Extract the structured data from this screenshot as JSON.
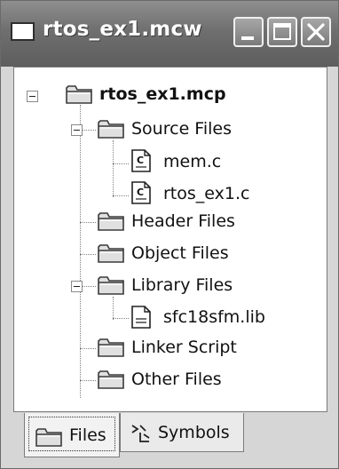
{
  "window": {
    "title": "rtos_ex1.mcw",
    "icon": "workspace-window-icon",
    "controls": {
      "minimize": "minimize-icon",
      "maximize": "maximize-icon",
      "close": "close-icon"
    }
  },
  "tree": {
    "project": "rtos_ex1.mcp",
    "folders": {
      "source": "Source Files",
      "header": "Header Files",
      "object": "Object Files",
      "library": "Library Files",
      "linker": "Linker Script",
      "other": "Other Files"
    },
    "files": {
      "mem_c": "mem.c",
      "rtos_ex1_c": "rtos_ex1.c",
      "sfc18sfm_lib": "sfc18sfm.lib"
    }
  },
  "tabs": {
    "files": "Files",
    "symbols": "Symbols",
    "active": "Files"
  }
}
